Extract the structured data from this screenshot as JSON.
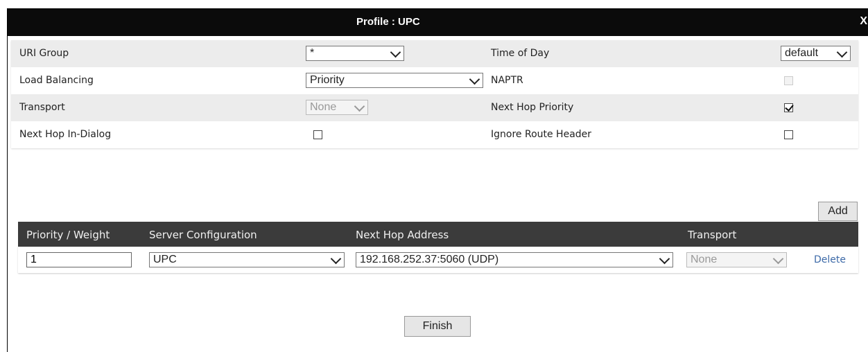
{
  "dialog": {
    "title": "Profile : UPC",
    "close_label": "X"
  },
  "settings": {
    "uri_group": {
      "label": "URI Group",
      "value": "*"
    },
    "time_of_day": {
      "label": "Time of Day",
      "value": "default"
    },
    "load_balancing": {
      "label": "Load Balancing",
      "value": "Priority"
    },
    "naptr": {
      "label": "NAPTR",
      "checked": false,
      "disabled": true
    },
    "transport": {
      "label": "Transport",
      "value": "None",
      "disabled": true
    },
    "next_hop_priority": {
      "label": "Next Hop Priority",
      "checked": true
    },
    "next_hop_in_dialog": {
      "label": "Next Hop In-Dialog",
      "checked": false
    },
    "ignore_route_header": {
      "label": "Ignore Route Header",
      "checked": false
    }
  },
  "add_label": "Add",
  "table": {
    "headers": [
      "Priority / Weight",
      "Server Configuration",
      "Next Hop Address",
      "Transport"
    ],
    "rows": [
      {
        "priority_weight": "1",
        "server_configuration": "UPC",
        "next_hop_address": "192.168.252.37:5060 (UDP)",
        "transport": "None",
        "delete_label": "Delete"
      }
    ]
  },
  "finish_label": "Finish",
  "colors": {
    "titlebar": "#0b0b0b",
    "table_header": "#3b3b3b",
    "row_shade": "#ececec",
    "link": "#3d6aa8"
  }
}
